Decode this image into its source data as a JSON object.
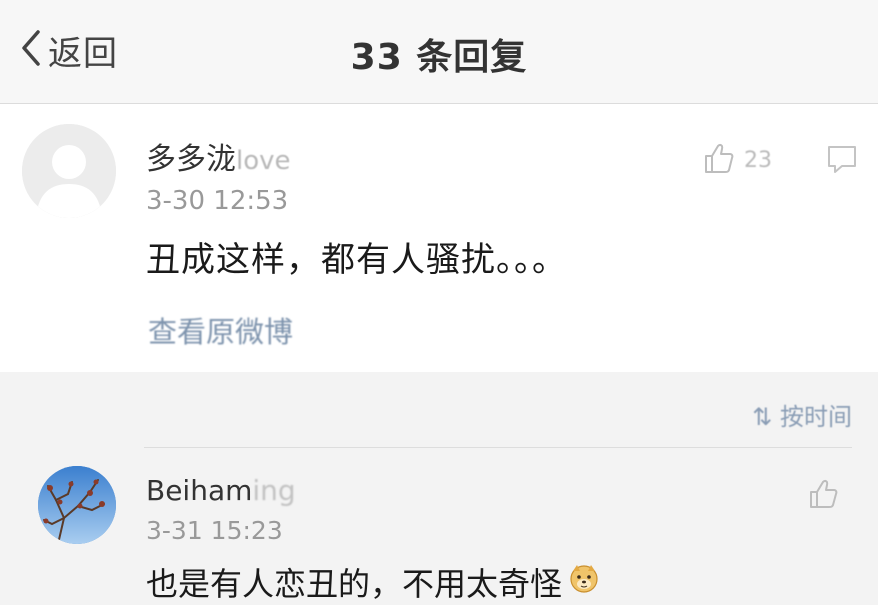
{
  "header": {
    "back_label": "返回",
    "title": "33 条回复"
  },
  "post": {
    "username": "多多泷",
    "username_suffix": "love",
    "time": "3-30 12:53",
    "content": "丑成这样，都有人骚扰。。。",
    "like_count": "23",
    "origin_link": "查看原微博"
  },
  "sort": {
    "label": "按时间"
  },
  "replies": [
    {
      "username": "Beiham",
      "username_suffix": "ing",
      "time": "3-31 15:23",
      "content": "也是有人恋丑的，不用太奇怪"
    }
  ],
  "colors": {
    "background": "#f3f3f3",
    "card": "#ffffff",
    "link": "#7d93ad",
    "muted_text": "#999999"
  },
  "icons": [
    "chevron-left-icon",
    "thumbs-up-icon",
    "comment-icon",
    "doge-emoji-icon"
  ]
}
